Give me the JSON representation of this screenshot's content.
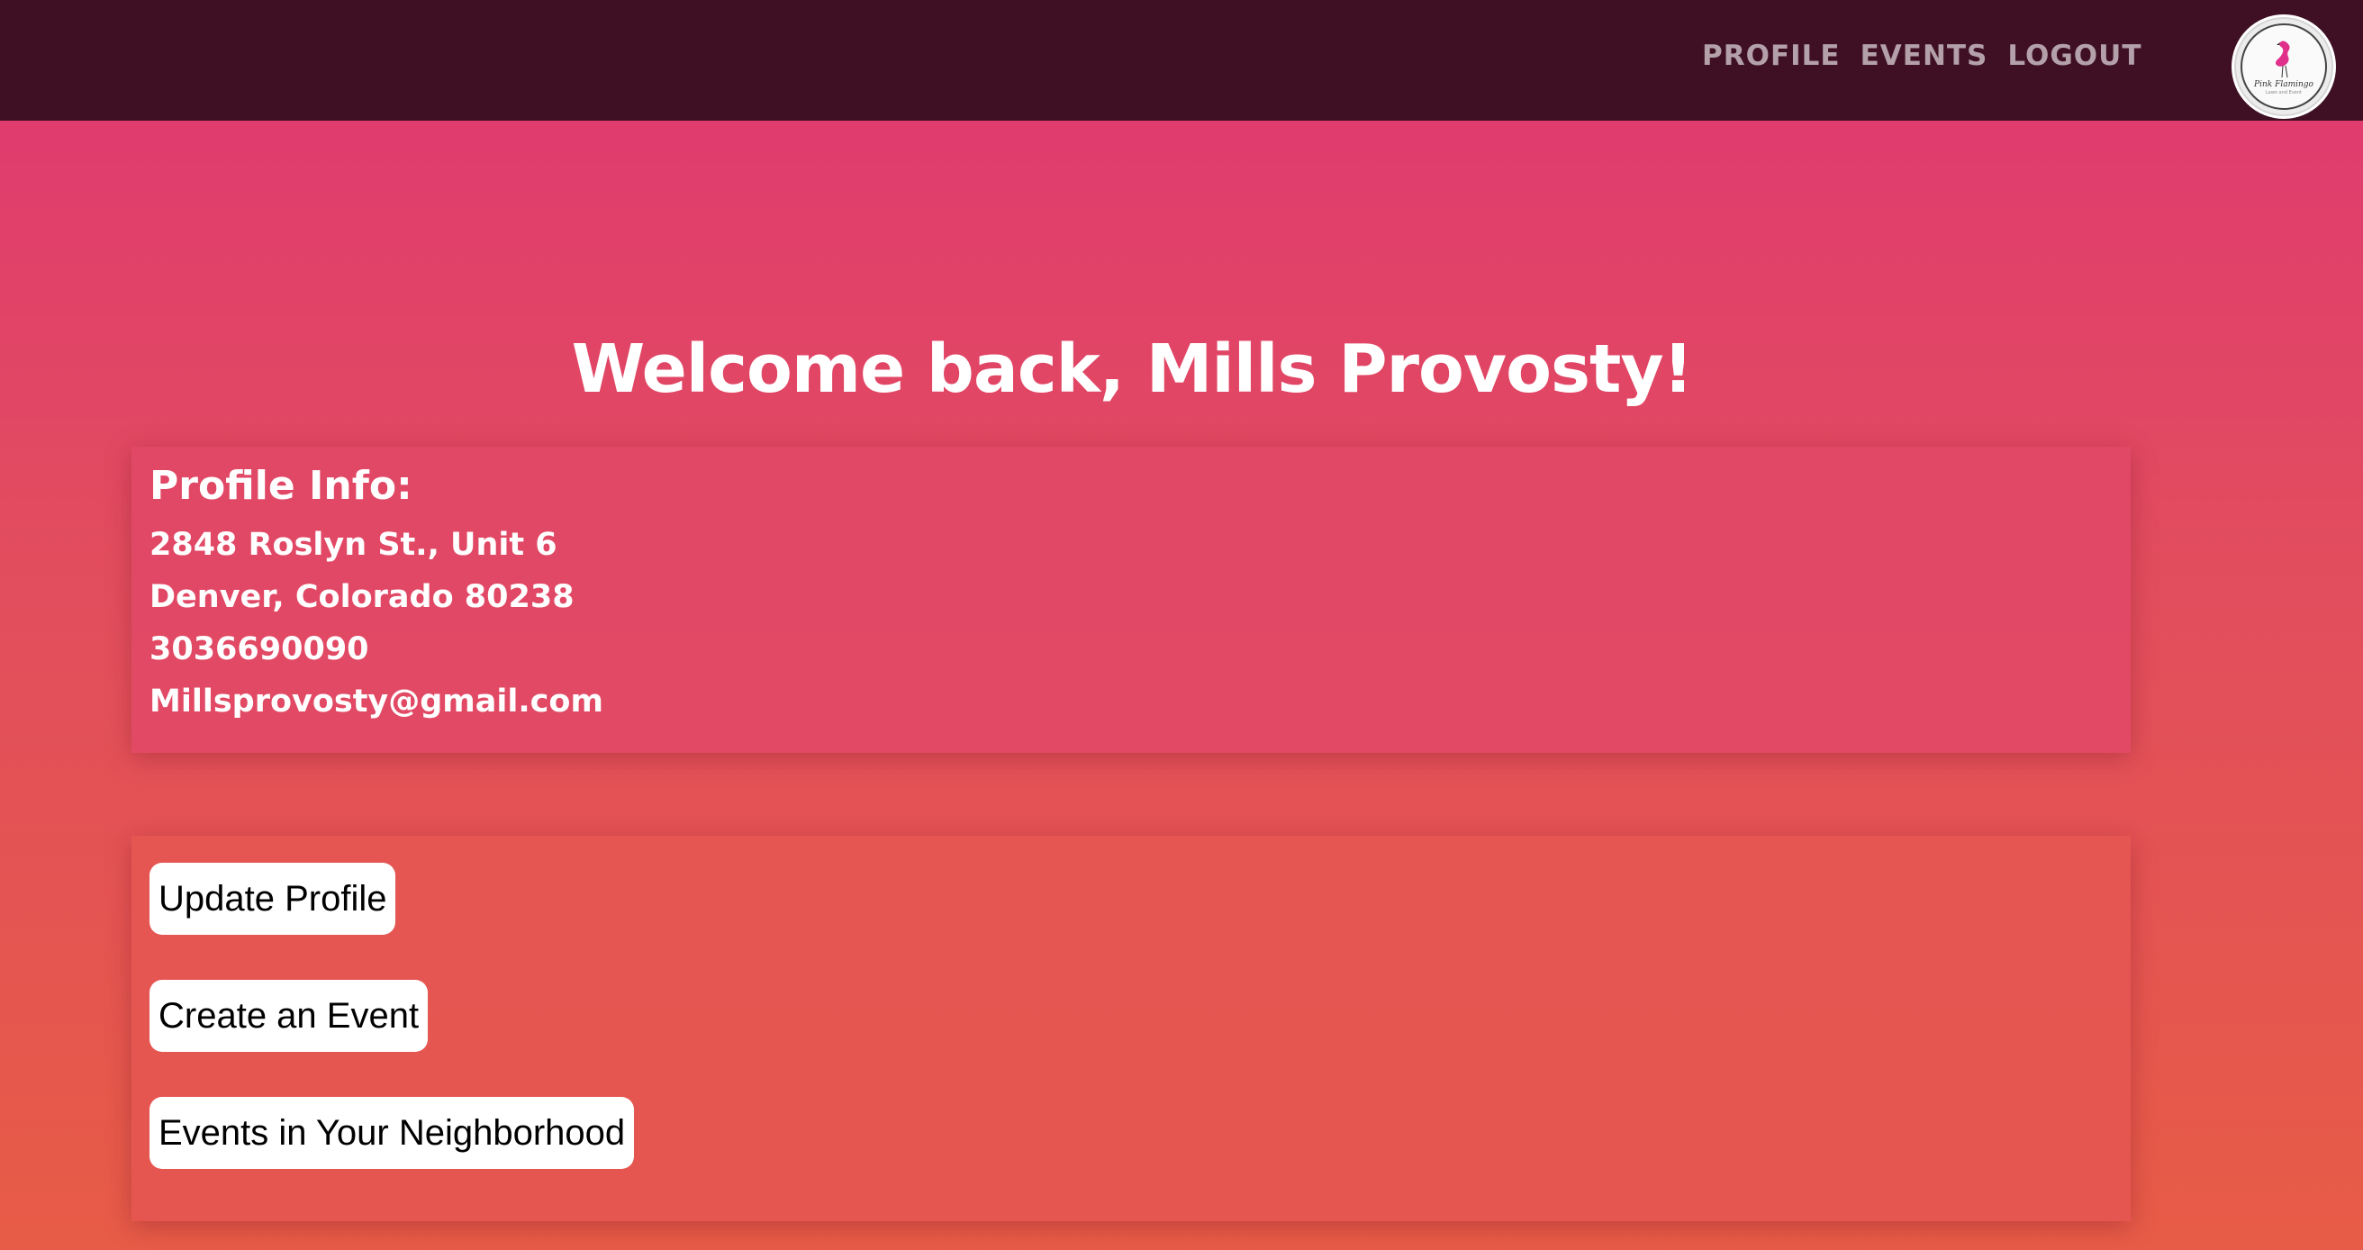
{
  "nav": {
    "items": [
      {
        "label": "PROFILE"
      },
      {
        "label": "EVENTS"
      },
      {
        "label": "LOGOUT"
      }
    ],
    "logo": {
      "text": "Pink Flamingo",
      "subtext": "Lawn and Event",
      "icon": "flamingo-icon"
    }
  },
  "welcome": {
    "title": "Welcome back, Mills Provosty!"
  },
  "profile": {
    "heading": "Profile Info:",
    "address_line1": "2848 Roslyn St., Unit 6",
    "address_line2": "Denver, Colorado 80238",
    "phone": "3036690090",
    "email": "Millsprovosty@gmail.com"
  },
  "actions": {
    "update_profile": "Update Profile",
    "create_event": "Create an Event",
    "neighborhood_events": "Events in Your Neighborhood"
  },
  "colors": {
    "topbar": "#3f1024",
    "gradient_top": "#df3772",
    "gradient_bottom": "#e75c46",
    "nav_text": "#b3a0a8",
    "accent_pink": "#e0308a"
  }
}
